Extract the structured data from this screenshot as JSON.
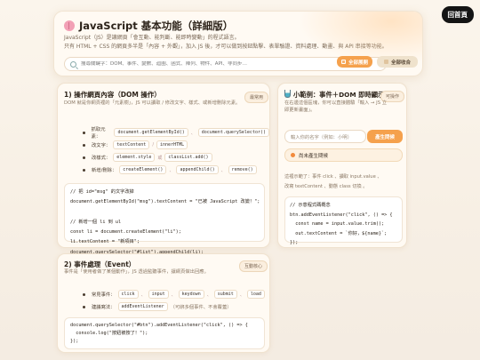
{
  "home_button": "回首頁",
  "header": {
    "title": "JavaScript 基本功能（詳細版）",
    "desc_line1": "JavaScript（JS）是讓網頁「會互動、能判斷、能即時變動」的程式語言。",
    "desc_line2": "只有 HTML + CSS 的網頁多半是「內容 + 外觀」，加入 JS 後，才可以做到按鈕點擊、表單驗證、資料處理、動畫、與 API 串接等功能。",
    "search_placeholder": "搜尋關鍵字：DOM、事件、變數、迴圈、函式、陣列、物件、API、非同步…",
    "expand_label": "全部展開",
    "collapse_label": "全部收合"
  },
  "card1": {
    "title": "1) 操作網頁內容（DOM 操作）",
    "subtitle": "DOM 就是你網頁裡的「元素樹」，JS 可以讀取 / 修改文字、樣式、或新增刪除元素。",
    "pill": "最常用",
    "bullets": [
      {
        "label": "抓取元素：",
        "items": [
          "document.getElementById()",
          "document.querySelector()"
        ],
        "seps": [
          "、"
        ]
      },
      {
        "label": "改文字：",
        "items": [
          "textContent",
          "innerHTML"
        ],
        "seps": [
          "/"
        ]
      },
      {
        "label": "改樣式：",
        "items": [
          "element.style",
          "classList.add()"
        ],
        "seps": [
          "或"
        ]
      },
      {
        "label": "新增/刪除：",
        "items": [
          "createElement()",
          "appendChild()",
          "remove()"
        ],
        "seps": [
          "、",
          "、"
        ]
      }
    ],
    "code": "// 把 id=\"msg\" 的文字改掉\ndocument.getElementById(\"msg\").textContent = \"已被 JavaScript 改變！\";\n\n// 新增一個 li 到 ul\nconst li = document.createElement(\"li\");\nli.textContent = \"新項目\";\ndocument.querySelector(\"#list\").appendChild(li);"
  },
  "card2": {
    "title": "2) 事件處理（Event）",
    "subtitle": "事件是「使用者做了某個動作」，JS 透過監聽事件，讓網頁做出回應。",
    "pill": "互動核心",
    "bullets": [
      {
        "label": "常見事件：",
        "items": [
          "click",
          "input",
          "keydown",
          "submit",
          "load"
        ],
        "seps": [
          "、",
          "、",
          "、",
          "、"
        ]
      },
      {
        "label": "建議寫法：",
        "items": [
          "addEventListener"
        ],
        "seps": [],
        "tail": "（可綁多個事件、不會覆蓋）"
      }
    ],
    "code": "document.querySelector(\"#btn\").addEventListener(\"click\", () => {\n  console.log(\"按鈕被按了！\");\n});"
  },
  "demo": {
    "title": "小範例：事件＋DOM 即時顯示",
    "pill": "可操作",
    "subtitle": "在右邊這個區塊，你可以直接體驗「輸入 → JS 立即更新畫面」。",
    "input_placeholder": "輸入你的名字（例如：小明）",
    "greet_label": "產生問候",
    "output_text": "尚未產生問候",
    "note_line1": "這裡示範了：事件 click 、讀取 input.value 、",
    "note_line2": "改寫 textContent 、動態 class 切換 。",
    "code": "// 示意程式碼概念\nbtn.addEventListener(\"click\", () => {\n  const name = input.value.trim();\n  out.textContent = `你好，${name}`;\n});"
  }
}
